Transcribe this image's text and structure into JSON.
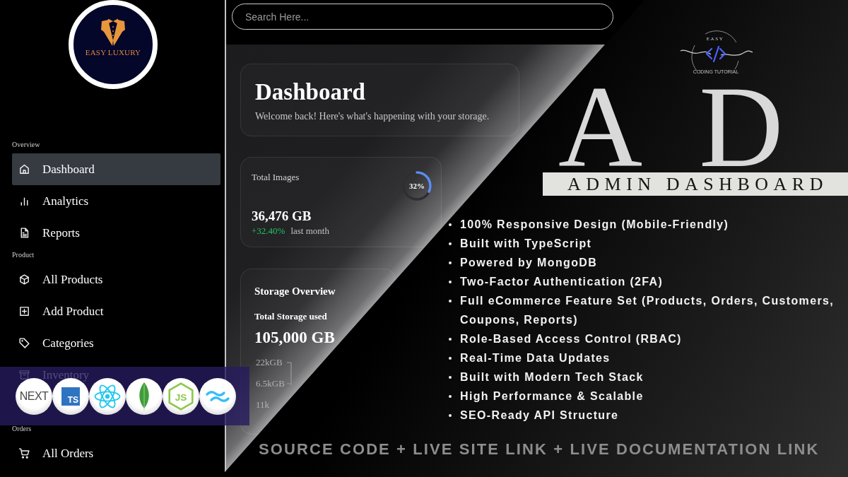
{
  "sidebar": {
    "logo": {
      "text": "EASY LUXURY"
    },
    "sections": [
      {
        "label": "Overview",
        "items": [
          {
            "label": "Dashboard",
            "selected": true
          },
          {
            "label": "Analytics",
            "selected": false
          },
          {
            "label": "Reports",
            "selected": false
          }
        ]
      },
      {
        "label": "Product",
        "items": [
          {
            "label": "All Products",
            "selected": false
          },
          {
            "label": "Add Product",
            "selected": false
          },
          {
            "label": "Categories",
            "selected": false
          },
          {
            "label": "Inventory",
            "selected": false
          }
        ]
      },
      {
        "label": "Orders",
        "items": [
          {
            "label": "All Orders",
            "selected": false
          }
        ]
      }
    ]
  },
  "search": {
    "placeholder": "Search Here..."
  },
  "header_card": {
    "title": "Dashboard",
    "subtitle": "Welcome back! Here's what's happening with your storage."
  },
  "stat_card": {
    "label": "Total Images",
    "ring": {
      "level": 0.32,
      "reading": "32%"
    },
    "value": "36,476 GB",
    "change": "+32.40%",
    "period": "last month"
  },
  "storage_card": {
    "title": "Storage Overview",
    "subtitle": "Total Storage used",
    "value": "105,000 GB",
    "axis_labels": [
      "22kGB",
      "6.5kGB",
      "11k"
    ]
  },
  "tech_band": {
    "logos": [
      {
        "kind": "wordmark",
        "text": "NEXT"
      },
      {
        "kind": "tile",
        "text": "TS"
      },
      {
        "kind": "atom"
      },
      {
        "kind": "leaf"
      },
      {
        "kind": "hexagon",
        "text": "JS"
      },
      {
        "kind": "waves"
      }
    ]
  },
  "promo": {
    "logo": {
      "top_text": "EASY",
      "bottom_text": "CODING TUTORIAL"
    },
    "monogram": [
      "A",
      "D"
    ],
    "banner": "ADMIN DASHBOARD",
    "features": [
      "100% Responsive Design (Mobile-Friendly)",
      "Built with TypeScript",
      "Powered by MongoDB",
      "Two-Factor Authentication (2FA)",
      "Full eCommerce Feature Set (Products, Orders, Customers, Coupons, Reports)",
      "Role-Based Access Control (RBAC)",
      "Real-Time Data Updates",
      "Built with Modern Tech Stack",
      "High Performance & Scalable",
      "SEO-Ready API Structure"
    ],
    "footer": "SOURCE CODE + LIVE SITE LINK + LIVE DOCUMENTATION LINK"
  }
}
